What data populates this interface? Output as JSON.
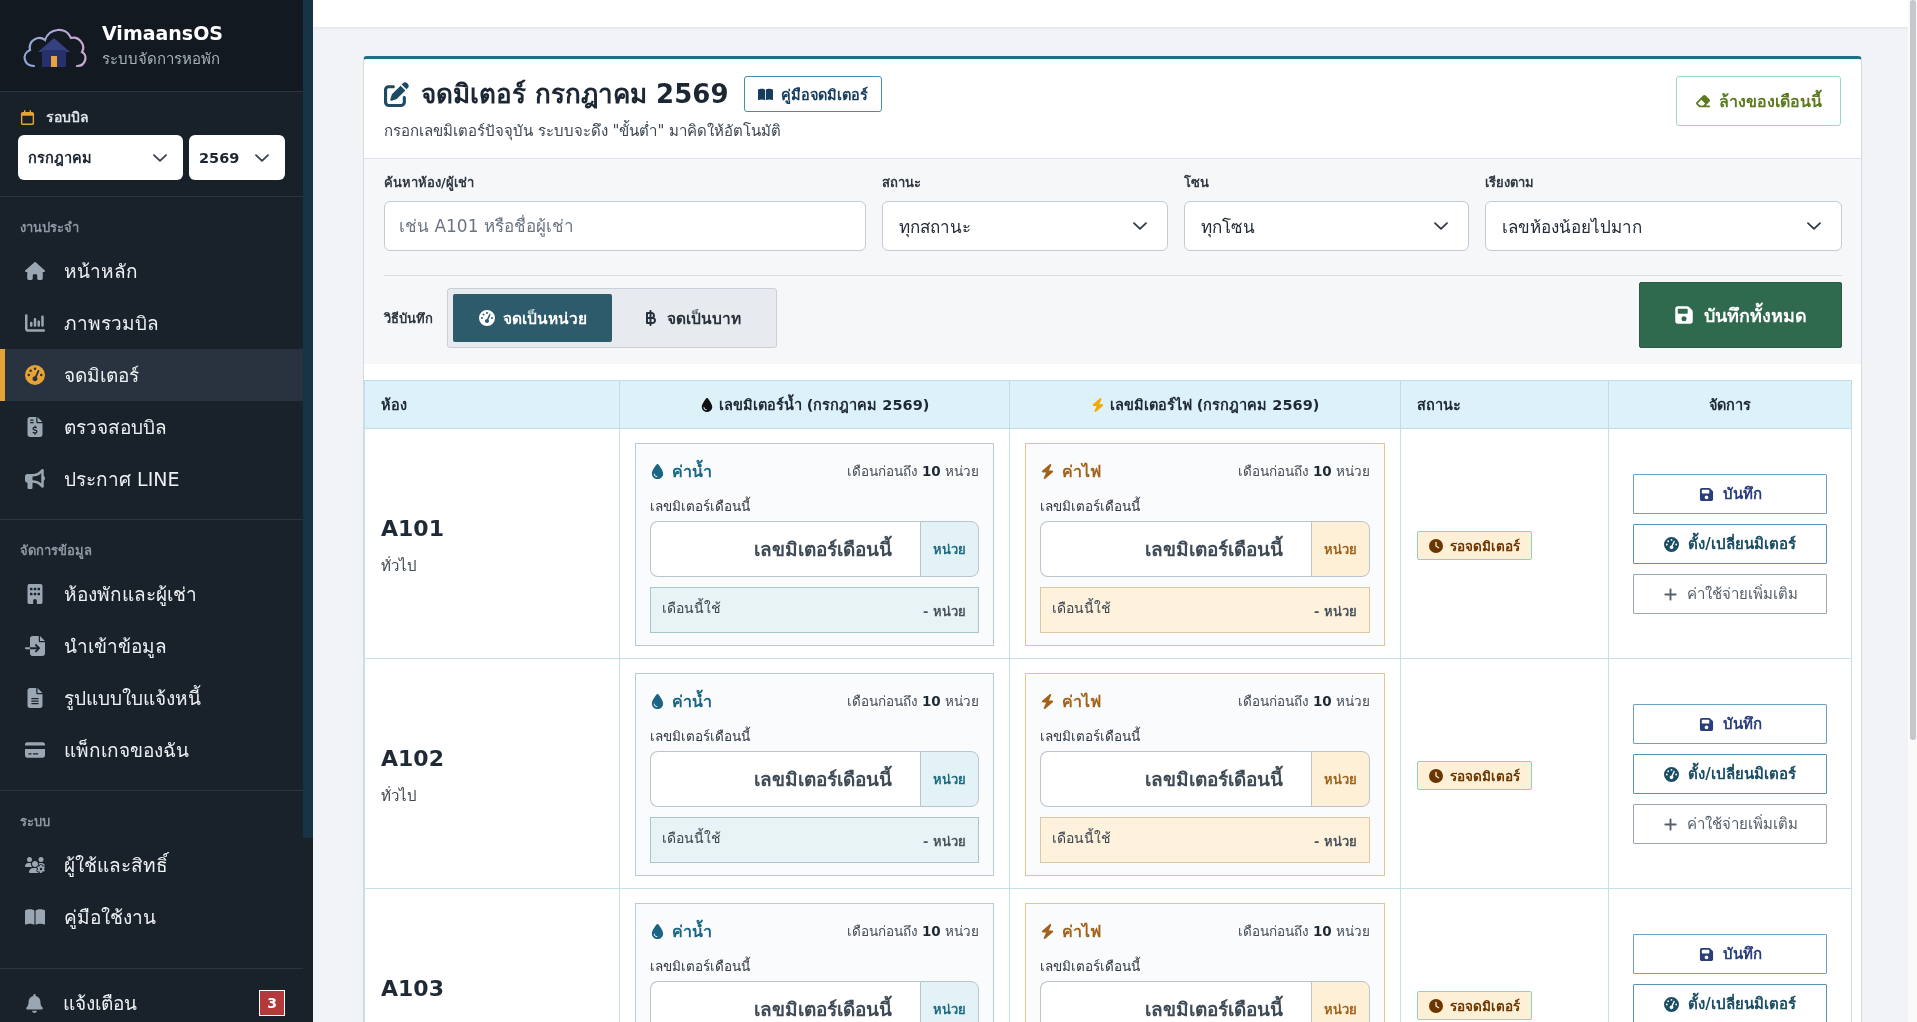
{
  "sidebar": {
    "brand": {
      "name": "VimaansOS",
      "subtitle": "ระบบจัดการหอพัก"
    },
    "billing_cycle": {
      "label": "รอบบิล",
      "month": "กรกฎาคม",
      "year": "2569"
    },
    "sections": [
      {
        "title": "งานประจำ",
        "items": [
          {
            "label": "หน้าหลัก",
            "selected": false
          },
          {
            "label": "ภาพรวมบิล",
            "selected": false
          },
          {
            "label": "จดมิเตอร์",
            "selected": true
          },
          {
            "label": "ตรวจสอบบิล",
            "selected": false
          },
          {
            "label": "ประกาศ LINE",
            "selected": false
          }
        ]
      },
      {
        "title": "จัดการข้อมูล",
        "items": [
          {
            "label": "ห้องพักและผู้เช่า",
            "selected": false
          },
          {
            "label": "นำเข้าข้อมูล",
            "selected": false
          },
          {
            "label": "รูปแบบใบแจ้งหนี้",
            "selected": false
          },
          {
            "label": "แพ็กเกจของฉัน",
            "selected": false
          }
        ]
      },
      {
        "title": "ระบบ",
        "items": [
          {
            "label": "ผู้ใช้และสิทธิ์",
            "selected": false
          },
          {
            "label": "คู่มือใช้งาน",
            "selected": false
          }
        ]
      }
    ],
    "notifications": {
      "label": "แจ้งเตือน",
      "count": "3"
    }
  },
  "header": {
    "title": "จดมิเตอร์ กรกฎาคม 2569",
    "guide_button": "คู่มือจดมิเตอร์",
    "subtitle": "กรอกเลขมิเตอร์ปัจจุบัน ระบบจะดึง \"ขั้นต่ำ\" มาคิดให้อัตโนมัติ",
    "clear_button": "ล้างของเดือนนี้"
  },
  "filters": [
    {
      "kind": "search",
      "label": "ค้นหาห้อง/ผู้เช่า",
      "placeholder": "เช่น A101 หรือชื่อผู้เช่า"
    },
    {
      "kind": "select",
      "label": "สถานะ",
      "value": "ทุกสถานะ"
    },
    {
      "kind": "select",
      "label": "โซน",
      "value": "ทุกโซน"
    },
    {
      "kind": "select",
      "label": "เรียงตาม",
      "value": "เลขห้องน้อยไปมาก"
    }
  ],
  "record_method": {
    "label": "วิธีบันทึก",
    "options": [
      {
        "label": "จดเป็นหน่วย",
        "selected": true
      },
      {
        "label": "จดเป็นบาท",
        "selected": false
      }
    ]
  },
  "save_all_button": "บันทึกทั้งหมด",
  "table": {
    "columns": [
      {
        "kind": "room",
        "label": "ห้อง"
      },
      {
        "kind": "water",
        "label": "เลขมิเตอร์น้ำ (กรกฎาคม 2569)"
      },
      {
        "kind": "electric",
        "label": "เลขมิเตอร์ไฟ (กรกฎาคม 2569)"
      },
      {
        "kind": "status",
        "label": "สถานะ"
      },
      {
        "kind": "actions",
        "label": "จัดการ"
      }
    ],
    "rows": [
      {
        "room": "A101",
        "zone": "ทั่วไป",
        "meters": [
          {
            "kind": "water",
            "title": "ค่าน้ำ",
            "previous": "เดือนก่อนถึง **10** หน่วย",
            "input_label": "เลขมิเตอร์เดือนนี้",
            "placeholder": "เลขมิเตอร์เดือนนี้",
            "unit": "หน่วย",
            "usage_label": "เดือนนี้ใช้",
            "usage_value": "- หน่วย"
          },
          {
            "kind": "electric",
            "title": "ค่าไฟ",
            "previous": "เดือนก่อนถึง **10** หน่วย",
            "input_label": "เลขมิเตอร์เดือนนี้",
            "placeholder": "เลขมิเตอร์เดือนนี้",
            "unit": "หน่วย",
            "usage_label": "เดือนนี้ใช้",
            "usage_value": "- หน่วย"
          }
        ],
        "status": "รอจดมิเตอร์",
        "actions": [
          {
            "kind": "save",
            "label": "บันทึก"
          },
          {
            "kind": "meter",
            "label": "ตั้ง/เปลี่ยนมิเตอร์"
          },
          {
            "kind": "extra",
            "label": "ค่าใช้จ่ายเพิ่มเติม"
          }
        ]
      },
      {
        "room": "A102",
        "zone": "ทั่วไป",
        "meters": [
          {
            "kind": "water",
            "title": "ค่าน้ำ",
            "previous": "เดือนก่อนถึง **10** หน่วย",
            "input_label": "เลขมิเตอร์เดือนนี้",
            "placeholder": "เลขมิเตอร์เดือนนี้",
            "unit": "หน่วย",
            "usage_label": "เดือนนี้ใช้",
            "usage_value": "- หน่วย"
          },
          {
            "kind": "electric",
            "title": "ค่าไฟ",
            "previous": "เดือนก่อนถึง **10** หน่วย",
            "input_label": "เลขมิเตอร์เดือนนี้",
            "placeholder": "เลขมิเตอร์เดือนนี้",
            "unit": "หน่วย",
            "usage_label": "เดือนนี้ใช้",
            "usage_value": "- หน่วย"
          }
        ],
        "status": "รอจดมิเตอร์",
        "actions": [
          {
            "kind": "save",
            "label": "บันทึก"
          },
          {
            "kind": "meter",
            "label": "ตั้ง/เปลี่ยนมิเตอร์"
          },
          {
            "kind": "extra",
            "label": "ค่าใช้จ่ายเพิ่มเติม"
          }
        ]
      },
      {
        "room": "A103",
        "meters": [
          {
            "kind": "water",
            "title": "ค่าน้ำ",
            "previous": "เดือนก่อนถึง **10** หน่วย",
            "input_label": "เลขมิเตอร์เดือนนี้",
            "placeholder": "เลขมิเตอร์เดือนนี้",
            "unit": "หน่วย"
          },
          {
            "kind": "electric",
            "title": "ค่าไฟ",
            "previous": "เดือนก่อนถึง **10** หน่วย",
            "input_label": "เลขมิเตอร์เดือนนี้",
            "placeholder": "เลขมิเตอร์เดือนนี้",
            "unit": "หน่วย"
          }
        ],
        "status": "รอจดมิเตอร์",
        "actions": [
          {
            "kind": "save",
            "label": "บันทึก"
          },
          {
            "kind": "meter",
            "label": "ตั้ง/เปลี่ยนมิเตอร์"
          }
        ]
      }
    ]
  }
}
